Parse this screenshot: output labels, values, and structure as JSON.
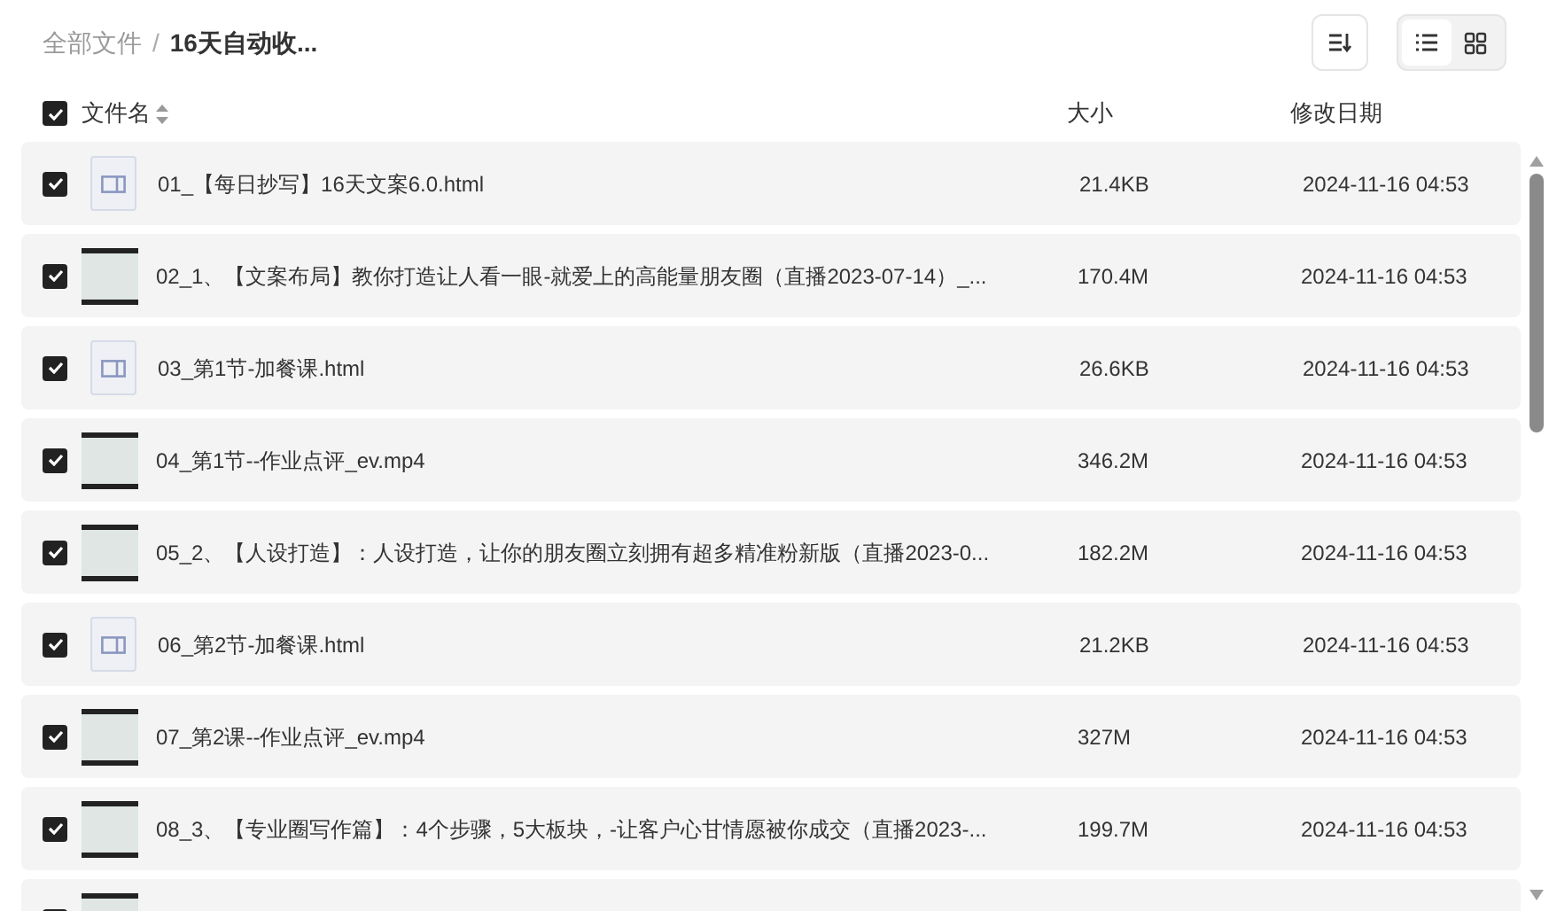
{
  "breadcrumb": [
    {
      "label": "全部文件",
      "current": false
    },
    {
      "label": "16天自动收...",
      "current": true
    }
  ],
  "breadcrumb_separator": "/",
  "view_toggle": [
    {
      "kind": "list",
      "selected": true
    },
    {
      "kind": "grid",
      "selected": false
    }
  ],
  "header": {
    "checked": true,
    "name": "文件名",
    "size": "大小",
    "date": "修改日期"
  },
  "rows": [
    {
      "kind": "html",
      "checked": true,
      "name": "01_【每日抄写】16天文案6.0.html",
      "size": "21.4KB",
      "date": "2024-11-16 04:53"
    },
    {
      "kind": "video",
      "checked": true,
      "name": "02_1、【文案布局】教你打造让人看一眼-就爱上的高能量朋友圈（直播2023-07-14）_...",
      "size": "170.4M",
      "date": "2024-11-16 04:53"
    },
    {
      "kind": "html",
      "checked": true,
      "name": "03_第1节-加餐课.html",
      "size": "26.6KB",
      "date": "2024-11-16 04:53"
    },
    {
      "kind": "video",
      "checked": true,
      "name": "04_第1节--作业点评_ev.mp4",
      "size": "346.2M",
      "date": "2024-11-16 04:53"
    },
    {
      "kind": "video",
      "checked": true,
      "name": "05_2、【人设打造】：人设打造，让你的朋友圈立刻拥有超多精准粉新版（直播2023-0...",
      "size": "182.2M",
      "date": "2024-11-16 04:53"
    },
    {
      "kind": "html",
      "checked": true,
      "name": "06_第2节-加餐课.html",
      "size": "21.2KB",
      "date": "2024-11-16 04:53"
    },
    {
      "kind": "video",
      "checked": true,
      "name": "07_第2课--作业点评_ev.mp4",
      "size": "327M",
      "date": "2024-11-16 04:53"
    },
    {
      "kind": "video",
      "checked": true,
      "name": "08_3、【专业圈写作篇】：4个步骤，5大板块，-让客户心甘情愿被你成交（直播2023-...",
      "size": "199.7M",
      "date": "2024-11-16 04:53"
    },
    {
      "kind": "video",
      "checked": true
    }
  ]
}
